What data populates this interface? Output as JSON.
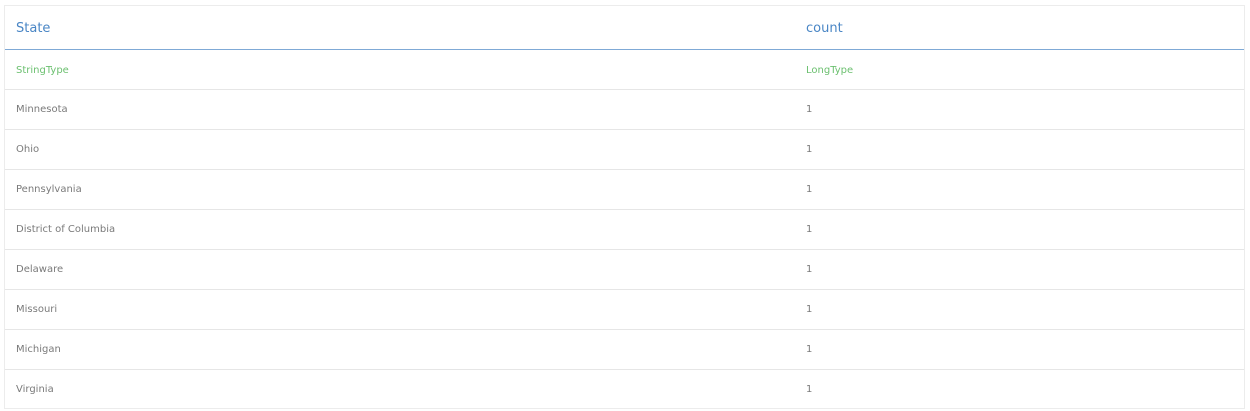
{
  "table": {
    "columns": [
      {
        "header": "State",
        "type": "StringType"
      },
      {
        "header": "count",
        "type": "LongType"
      }
    ],
    "rows": [
      [
        "Minnesota",
        "1"
      ],
      [
        "Ohio",
        "1"
      ],
      [
        "Pennsylvania",
        "1"
      ],
      [
        "District of Columbia",
        "1"
      ],
      [
        "Delaware",
        "1"
      ],
      [
        "Missouri",
        "1"
      ],
      [
        "Michigan",
        "1"
      ],
      [
        "Virginia",
        "1"
      ]
    ]
  },
  "colors": {
    "header_text": "#4a86c5",
    "type_text": "#6cc070",
    "cell_text": "#7a7a7a",
    "header_rule": "#7fa9d6",
    "row_rule": "#e6e6e6"
  }
}
